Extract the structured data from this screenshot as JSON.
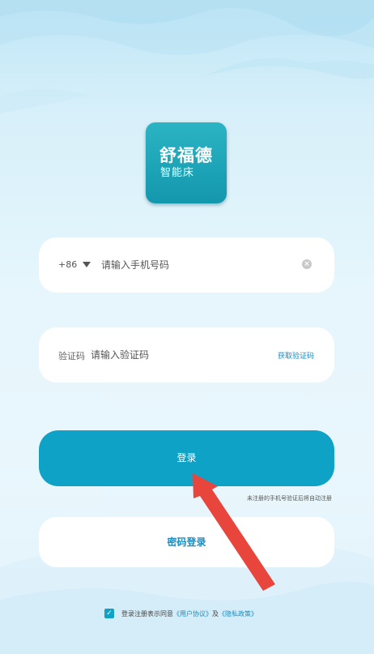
{
  "logo": {
    "brand": "舒福德",
    "product": "智能床"
  },
  "phone": {
    "country_code": "+86",
    "placeholder": "请输入手机号码"
  },
  "code": {
    "label": "验证码",
    "placeholder": "请输入验证码",
    "get_code": "获取验证码"
  },
  "login": {
    "label": "登录",
    "auto_register_note": "未注册的手机号验证后将自动注册"
  },
  "password_login": {
    "label": "密码登录"
  },
  "agreement": {
    "prefix": "登录注册表示同意",
    "user_agreement": "《用户协议》",
    "and": "及",
    "privacy_policy": "《隐私政策》",
    "checked": true
  },
  "colors": {
    "accent": "#0ea2c6",
    "link": "#1a8cc0",
    "annotation_arrow": "#e8453c"
  },
  "icons": {
    "caret": "caret-down-icon",
    "clear": "clear-icon",
    "check": "check-icon",
    "annotation": "annotation-arrow-icon"
  }
}
